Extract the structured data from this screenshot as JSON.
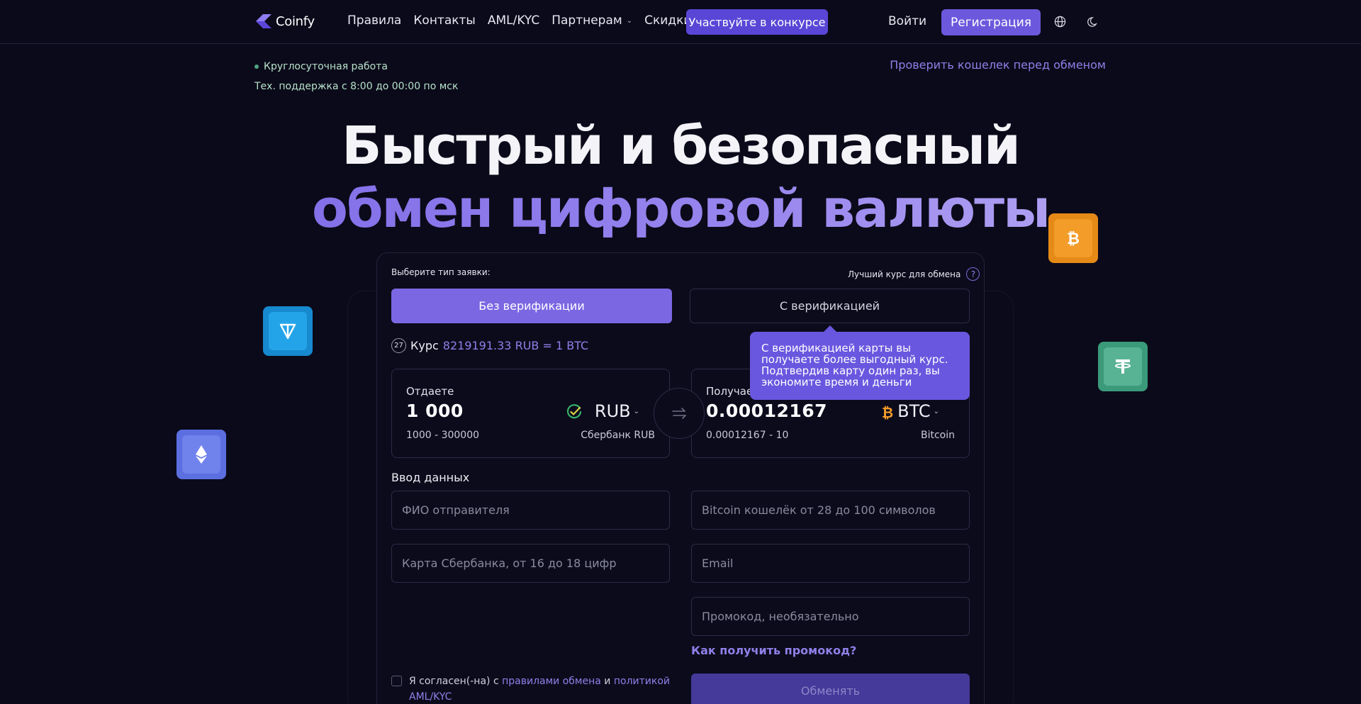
{
  "brand": {
    "name": "Coinfy"
  },
  "nav": {
    "items": [
      "Правила",
      "Контакты",
      "AML/KYC",
      "Партнерам",
      "Скидки"
    ],
    "contest": "Участвуйте в конкурсе",
    "login": "Войти",
    "register": "Регистрация"
  },
  "info": {
    "status": "Круглосуточная работа",
    "support": "Тех. поддержка с 8:00 до 00:00 по мск",
    "check_wallet": "Проверить кошелек перед обменом"
  },
  "hero": {
    "line1": "Быстрый и безопасный",
    "line2": "обмен цифровой валюты"
  },
  "form": {
    "type_label": "Выберите тип заявки:",
    "best_rate": "Лучший курс для обмена",
    "help": "?",
    "tab_no_verif": "Без верификации",
    "tab_verif": "С верификацией",
    "timer": "27",
    "rate_word": "Курс",
    "rate_value": "8219191.33 RUB = 1 BTC",
    "tooltip": "С верификацией карты вы получаете более выгодный курс. Подтвердив карту один раз, вы экономите время и деньги",
    "give": {
      "label": "Отдаете",
      "amount": "1 000",
      "range": "1000 - 300000",
      "currency": "RUB",
      "bank": "Сбербанк RUB"
    },
    "get": {
      "label": "Получаете",
      "amount": "0.00012167",
      "range": "0.00012167 - 10",
      "currency": "BTC",
      "bank": "Bitcoin"
    },
    "data_heading": "Ввод данных",
    "placeholders": {
      "fio": "ФИО отправителя",
      "wallet": "Bitcoin кошелёк от 28 до 100 символов",
      "card": "Карта Сбербанка, от 16 до 18 цифр",
      "email": "Email",
      "promo": "Промокод, необязательно"
    },
    "promo_link": "Как получить промокод?",
    "agree": {
      "prefix": "Я согласен(-на) с",
      "rules_link": "правилами обмена",
      "and": "и",
      "policy_link": "политикой AML/KYC"
    },
    "submit": "Обменять"
  },
  "colors": {
    "background": "#0b0a1a",
    "accent": "#6c58dd",
    "accent_text": "#8e80e8",
    "status_text": "#b6e2c9"
  },
  "icons": [
    "logo-icon",
    "chevron-down-icon",
    "globe-icon",
    "moon-icon",
    "bitcoin-icon",
    "ton-icon",
    "tether-icon",
    "ethereum-icon",
    "swap-icon",
    "check-circle-icon",
    "help-icon",
    "timer-icon"
  ]
}
